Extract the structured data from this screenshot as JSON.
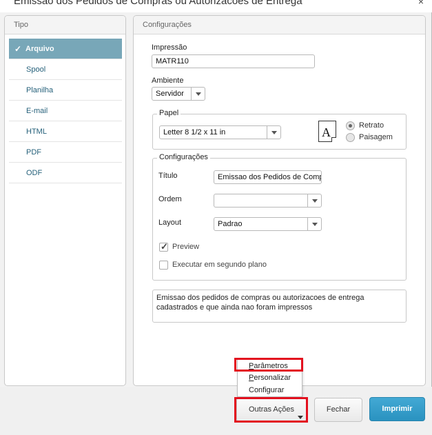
{
  "window": {
    "title": "Emissao dos Pedidos de Compras ou Autorizacoes de Entrega",
    "close_glyph": "×"
  },
  "tipo": {
    "header": "Tipo",
    "items": [
      {
        "label": "Arquivo",
        "active": true
      },
      {
        "label": "Spool",
        "active": false
      },
      {
        "label": "Planilha",
        "active": false
      },
      {
        "label": "E-mail",
        "active": false
      },
      {
        "label": "HTML",
        "active": false
      },
      {
        "label": "PDF",
        "active": false
      },
      {
        "label": "ODF",
        "active": false
      }
    ]
  },
  "config": {
    "header": "Configurações",
    "impressao_label": "Impressão",
    "impressao_value": "MATR110",
    "ambiente_label": "Ambiente",
    "ambiente_value": "Servidor",
    "papel": {
      "legend": "Papel",
      "size_value": "Letter 8 1/2 x 11 in",
      "doc_glyph": "A",
      "orientation": [
        {
          "label": "Retrato",
          "selected": true
        },
        {
          "label": "Paisagem",
          "selected": false
        }
      ]
    },
    "configuracoes": {
      "legend": "Configurações",
      "titulo_label": "Título",
      "titulo_value": "Emissao dos Pedidos de Compras ou Autorizacoes de Entrega",
      "ordem_label": "Ordem",
      "ordem_value": "",
      "layout_label": "Layout",
      "layout_value": "Padrao",
      "preview_label": "Preview",
      "preview_checked": true,
      "background_label": "Executar em segundo plano",
      "background_checked": false
    },
    "description_line1": "Emissao dos pedidos de compras ou autorizacoes de entrega",
    "description_line2": "cadastrados e que ainda nao foram impressos"
  },
  "menu": {
    "items": [
      {
        "label_u": "P",
        "label_rest": "arâmetros"
      },
      {
        "label_u": "P",
        "label_rest": "ersonalizar"
      },
      {
        "label_u": "",
        "label_rest": "Configurar"
      }
    ]
  },
  "footer": {
    "outras_acoes": "Outras Ações",
    "fechar": "Fechar",
    "imprimir": "Imprimir"
  },
  "colors": {
    "highlight": "#e3101e",
    "primary": "#2a92c0",
    "active_item": "#78a7b8"
  }
}
